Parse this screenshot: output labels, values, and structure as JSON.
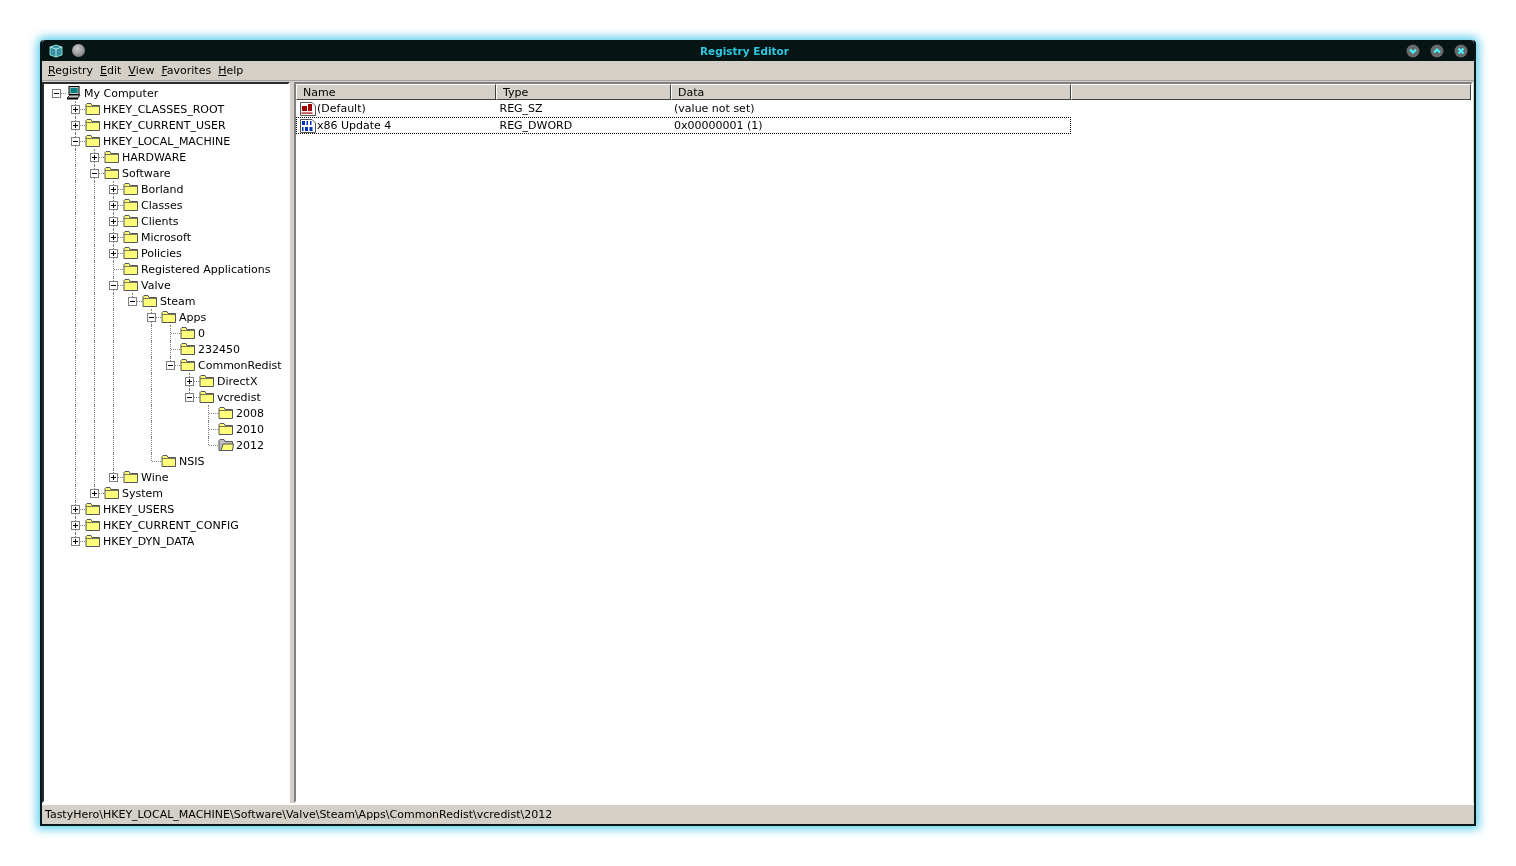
{
  "window": {
    "title": "Registry Editor"
  },
  "menu": [
    {
      "label": "Registry"
    },
    {
      "label": "Edit"
    },
    {
      "label": "View"
    },
    {
      "label": "Favorites"
    },
    {
      "label": "Help"
    }
  ],
  "tree": [
    {
      "label": "My Computer",
      "kind": "computer",
      "expanded": true,
      "children": [
        {
          "label": "HKEY_CLASSES_ROOT",
          "kind": "folder",
          "expanded": false,
          "selected": false
        },
        {
          "label": "HKEY_CURRENT_USER",
          "kind": "folder",
          "expanded": false,
          "selected": false
        },
        {
          "label": "HKEY_LOCAL_MACHINE",
          "kind": "folder",
          "expanded": true,
          "selected": false,
          "children": [
            {
              "label": "HARDWARE",
              "kind": "folder",
              "expanded": false,
              "selected": false
            },
            {
              "label": "Software",
              "kind": "folder",
              "expanded": true,
              "selected": false,
              "children": [
                {
                  "label": "Borland",
                  "kind": "folder",
                  "expanded": false,
                  "selected": false
                },
                {
                  "label": "Classes",
                  "kind": "folder",
                  "expanded": false,
                  "selected": false
                },
                {
                  "label": "Clients",
                  "kind": "folder",
                  "expanded": false,
                  "selected": false
                },
                {
                  "label": "Microsoft",
                  "kind": "folder",
                  "expanded": false,
                  "selected": false
                },
                {
                  "label": "Policies",
                  "kind": "folder",
                  "expanded": false,
                  "selected": false
                },
                {
                  "label": "Registered Applications",
                  "kind": "folder",
                  "selected": false
                },
                {
                  "label": "Valve",
                  "kind": "folder",
                  "expanded": true,
                  "selected": false,
                  "children": [
                    {
                      "label": "Steam",
                      "kind": "folder",
                      "expanded": true,
                      "selected": false,
                      "children": [
                        {
                          "label": "Apps",
                          "kind": "folder",
                          "expanded": true,
                          "selected": false,
                          "children": [
                            {
                              "label": "0",
                              "kind": "folder",
                              "selected": false
                            },
                            {
                              "label": "232450",
                              "kind": "folder",
                              "selected": false
                            },
                            {
                              "label": "CommonRedist",
                              "kind": "folder",
                              "expanded": true,
                              "selected": false,
                              "children": [
                                {
                                  "label": "DirectX",
                                  "kind": "folder",
                                  "expanded": false,
                                  "selected": false
                                },
                                {
                                  "label": "vcredist",
                                  "kind": "folder",
                                  "expanded": true,
                                  "selected": false,
                                  "children": [
                                    {
                                      "label": "2008",
                                      "kind": "folder",
                                      "selected": false
                                    },
                                    {
                                      "label": "2010",
                                      "kind": "folder",
                                      "selected": false
                                    },
                                    {
                                      "label": "2012",
                                      "kind": "folder",
                                      "selected": true
                                    }
                                  ]
                                }
                              ]
                            }
                          ]
                        },
                        {
                          "label": "NSIS",
                          "kind": "folder",
                          "selected": false
                        }
                      ]
                    }
                  ]
                },
                {
                  "label": "Wine",
                  "kind": "folder",
                  "expanded": false,
                  "selected": false
                }
              ]
            },
            {
              "label": "System",
              "kind": "folder",
              "expanded": false,
              "selected": false
            }
          ]
        },
        {
          "label": "HKEY_USERS",
          "kind": "folder",
          "expanded": false,
          "selected": false
        },
        {
          "label": "HKEY_CURRENT_CONFIG",
          "kind": "folder",
          "expanded": false,
          "selected": false
        },
        {
          "label": "HKEY_DYN_DATA",
          "kind": "folder",
          "expanded": false,
          "selected": false
        }
      ]
    }
  ],
  "values": {
    "columns": [
      "Name",
      "Type",
      "Data"
    ],
    "rows": [
      {
        "name": "(Default)",
        "type": "REG_SZ",
        "data": "(value not set)",
        "kind": "string",
        "selected": false
      },
      {
        "name": "x86 Update 4",
        "type": "REG_DWORD",
        "data": "0x00000001 (1)",
        "kind": "binary",
        "selected": true
      }
    ]
  },
  "status_bar": "TastyHero\\HKEY_LOCAL_MACHINE\\Software\\Valve\\Steam\\Apps\\CommonRedist\\vcredist\\2012"
}
